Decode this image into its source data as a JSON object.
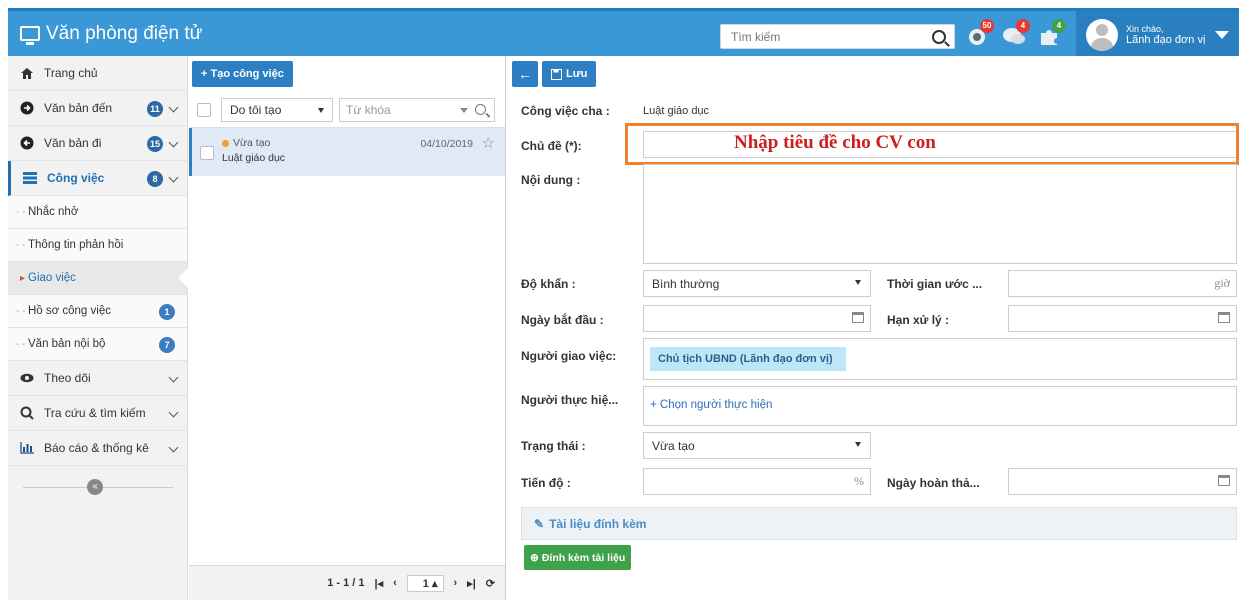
{
  "header": {
    "title": "Văn phòng điện tử",
    "search_placeholder": "Tìm kiếm",
    "badges": {
      "notify": "50",
      "messages": "4",
      "plugins": "4"
    },
    "greeting": "Xin chào,",
    "user": "Lãnh đạo đơn vị",
    "accent": "#3a98d6"
  },
  "sidebar": {
    "items": [
      {
        "label": "Trang chủ",
        "icon": "home-icon"
      },
      {
        "label": "Văn bản đến",
        "count": "11",
        "icon": "arrow-right-circle-icon"
      },
      {
        "label": "Văn bản đi",
        "count": "15",
        "icon": "arrow-left-circle-icon"
      },
      {
        "label": "Công việc",
        "count": "8",
        "icon": "tasks-icon"
      }
    ],
    "sub": [
      {
        "label": "Nhắc nhở"
      },
      {
        "label": "Thông tin phản hồi"
      },
      {
        "label": "Giao việc"
      },
      {
        "label": "Hồ sơ công việc",
        "count": "1"
      },
      {
        "label": "Văn bản nội bộ",
        "count": "7"
      }
    ],
    "more": [
      {
        "label": "Theo dõi",
        "icon": "eye-icon"
      },
      {
        "label": "Tra cứu & tìm kiếm",
        "icon": "search-icon"
      },
      {
        "label": "Báo cáo & thống kê",
        "icon": "bar-chart-icon"
      }
    ],
    "collapse": "«"
  },
  "list": {
    "create_label": "+ Tạo công việc",
    "filter_value": "Do tôi tạo",
    "keyword_placeholder": "Từ khóa",
    "rows": [
      {
        "status": "Vừa tạo",
        "title": "Luật giáo dục",
        "date": "04/10/2019"
      }
    ],
    "pager": {
      "range": "1 - 1 / 1",
      "page": "1"
    }
  },
  "form": {
    "save_label": "Lưu",
    "parent_label": "Công việc cha :",
    "parent_value": "Luật giáo dục",
    "subject_label": "Chủ đề (*):",
    "subject_hint": "Nhập tiêu đề cho CV con",
    "content_label": "Nội dung :",
    "urgency_label": "Độ khẩn :",
    "urgency_value": "Bình thường",
    "est_time_label": "Thời gian ước ...",
    "est_unit": "giờ",
    "start_label": "Ngày bắt đầu :",
    "deadline_label": "Hạn xử lý :",
    "assigner_label": "Người giao việc:",
    "assigner_value": "Chủ tịch UBND (Lãnh đạo đơn vị)",
    "executor_label": "Người thực hiệ...",
    "executor_pick": "+ Chọn người thực hiện",
    "status_label": "Trạng thái :",
    "status_value": "Vừa tạo",
    "progress_label": "Tiến độ :",
    "progress_unit": "%",
    "complete_label": "Ngày hoàn thả...",
    "attach_title": "Tài liệu đính kèm",
    "attach_button": "Đính kèm tài liệu"
  }
}
